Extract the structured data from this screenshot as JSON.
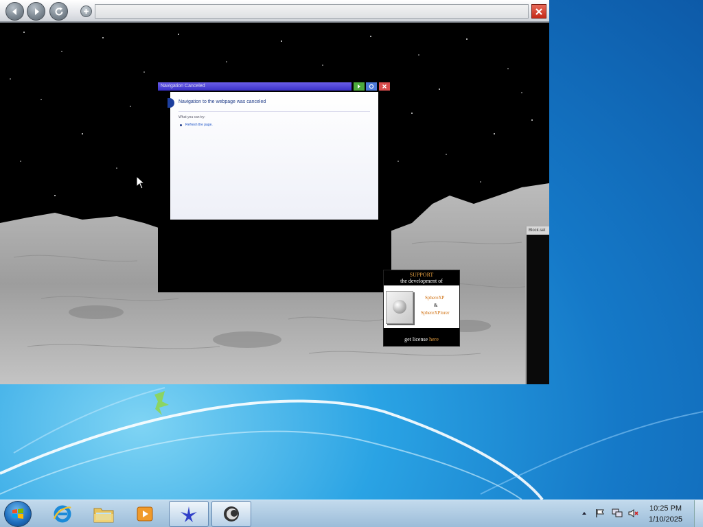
{
  "window": {
    "address_value": "",
    "icons": {
      "back": "back-arrow-icon",
      "forward": "forward-arrow-icon",
      "reload": "reload-icon",
      "add": "add-icon",
      "close": "close-icon"
    }
  },
  "panel": {
    "title": "Navigation Canceled",
    "heading": "Navigation to the webpage was canceled",
    "subheading": "What you can try:",
    "action_link": "Refresh the page."
  },
  "ad": {
    "line1": "SUPPORT",
    "line2": "the development of",
    "product1": "SphereXP",
    "amp": "&",
    "product2": "SphereXPlorer",
    "license_prefix": "get license",
    "license_link": "here"
  },
  "side_window": {
    "title": "Block.set"
  },
  "taskbar": {
    "items": [
      {
        "name": "internet-explorer",
        "active": false
      },
      {
        "name": "windows-explorer",
        "active": false
      },
      {
        "name": "media-player",
        "active": false
      },
      {
        "name": "bird-app",
        "active": true
      },
      {
        "name": "spherexplorer",
        "active": true
      }
    ],
    "clock": {
      "time": "10:25 PM",
      "date": "1/10/2025"
    }
  },
  "colors": {
    "accent_red": "#c42a18",
    "panel_title": "#3a30c8",
    "ad_orange": "#e8a040"
  }
}
